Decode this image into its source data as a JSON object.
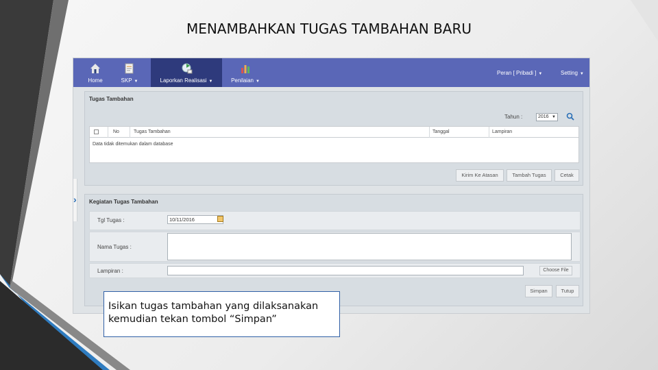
{
  "slide": {
    "title": "MENAMBAHKAN TUGAS TAMBAHAN BARU"
  },
  "navbar": {
    "items": [
      {
        "label": "Home",
        "icon": "home-icon"
      },
      {
        "label": "SKP",
        "icon": "document-icon",
        "caret": "▼"
      },
      {
        "label": "Laporkan Realisasi",
        "icon": "report-icon",
        "caret": "▼",
        "active": true
      },
      {
        "label": "Penilaian",
        "icon": "chart-icon",
        "caret": "▼"
      }
    ],
    "right": [
      {
        "label": "Peran [ Pribadi ]",
        "caret": "▼"
      },
      {
        "label": "Setting",
        "caret": "▼"
      }
    ],
    "accent": "#5a67b7",
    "active_bg": "#2e3a7c"
  },
  "tugas_tambahan": {
    "title": "Tugas Tambahan",
    "year_label": "Tahun :",
    "year_value": "2016",
    "columns": [
      "No",
      "Tugas Tambahan",
      "Tanggal",
      "Lampiran"
    ],
    "empty_message": "Data tidak ditemukan dalam database",
    "buttons": {
      "kirim": "Kirim Ke Atasan",
      "tambah": "Tambah Tugas",
      "cetak": "Cetak"
    }
  },
  "kegiatan": {
    "title": "Kegiatan Tugas Tambahan",
    "tgl_label": "Tgl Tugas :",
    "tgl_value": "10/11/2016",
    "nama_label": "Nama Tugas :",
    "nama_value": "",
    "lampiran_label": "Lampiran :",
    "choose_file": "Choose File",
    "buttons": {
      "simpan": "Simpan",
      "tutup": "Tutup"
    }
  },
  "callout": {
    "line1": "Isikan tugas tambahan yang dilaksanakan",
    "line2": "kemudian tekan tombol “Simpan”"
  }
}
